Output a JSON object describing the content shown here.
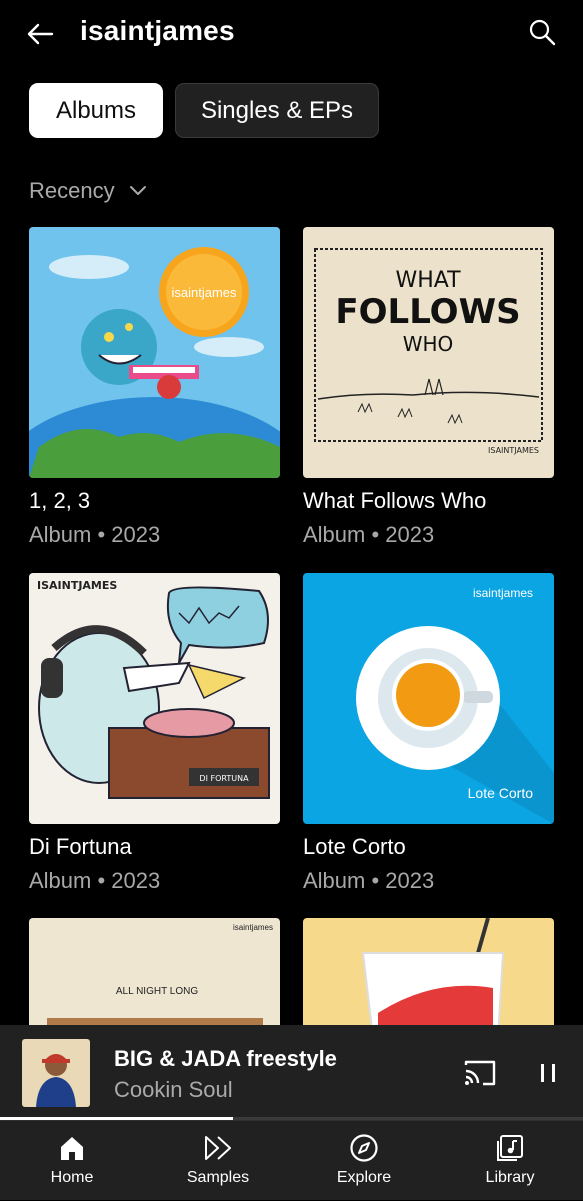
{
  "header": {
    "title": "isaintjames"
  },
  "chips": [
    {
      "label": "Albums",
      "active": true
    },
    {
      "label": "Singles & EPs",
      "active": false
    }
  ],
  "sort": {
    "label": "Recency"
  },
  "albums": [
    {
      "title": "1, 2, 3",
      "meta": "Album • 2023",
      "art_text": "isaintjames"
    },
    {
      "title": "What Follows Who",
      "meta": "Album • 2023",
      "art_text": "WHAT",
      "art_text2": "FOLLOWS",
      "art_text3": "WHO",
      "art_text4": "ISAINTJAMES"
    },
    {
      "title": "Di Fortuna",
      "meta": "Album • 2023",
      "art_text": "ISAINTJAMES",
      "art_text2": "DI FORTUNA"
    },
    {
      "title": "Lote Corto",
      "meta": "Album • 2023",
      "art_text": "isaintjames",
      "art_text2": "Lote Corto"
    },
    {
      "title": "",
      "meta": "",
      "art_text": "isaintjames",
      "art_text2": "ALL NIGHT LONG"
    },
    {
      "title": "",
      "meta": "",
      "art_text": ""
    }
  ],
  "now_playing": {
    "title": "BIG & JADA freestyle",
    "artist": "Cookin Soul",
    "progress": 0.4
  },
  "nav": [
    {
      "label": "Home",
      "icon": "home-icon",
      "active": true
    },
    {
      "label": "Samples",
      "icon": "samples-icon",
      "active": false
    },
    {
      "label": "Explore",
      "icon": "explore-icon",
      "active": false
    },
    {
      "label": "Library",
      "icon": "library-icon",
      "active": false
    }
  ],
  "colors": {
    "background": "#000000",
    "surface": "#212121",
    "secondary_text": "#aaaaaa",
    "lote_corto_blue": "#0ba5e4"
  }
}
